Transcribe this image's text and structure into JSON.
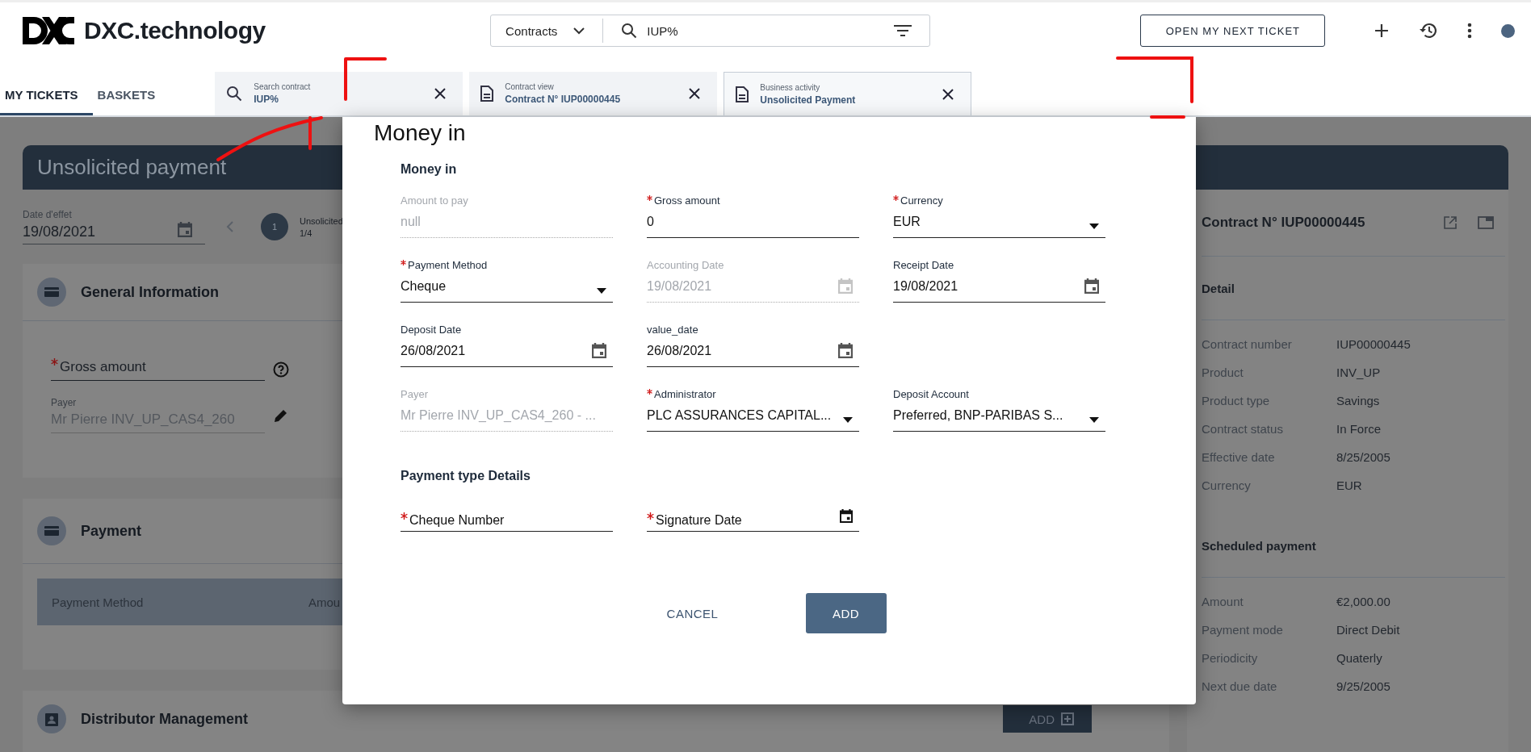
{
  "header": {
    "logo": "DXC.technology",
    "search": {
      "scope": "Contracts",
      "value": "IUP%"
    },
    "next_ticket_button": "OPEN MY NEXT TICKET"
  },
  "nav_tabs": [
    {
      "label": "MY TICKETS",
      "selected": true
    },
    {
      "label": "BASKETS",
      "selected": false
    }
  ],
  "open_tabs": [
    {
      "kind": "search",
      "caption": "Search contract",
      "title": "IUP%",
      "selected": false
    },
    {
      "kind": "document",
      "caption": "Contract view",
      "title": "Contract N° IUP00000445",
      "selected": false
    },
    {
      "kind": "document",
      "caption": "Business activity",
      "title": "Unsolicited Payment",
      "selected": true
    }
  ],
  "page": {
    "title": "Unsolicited payment",
    "effective_date": {
      "label": "Date d'effet",
      "value": "19/08/2021"
    },
    "stepper": {
      "number": "1",
      "label": "Unsolicited",
      "count": "1/4"
    },
    "general_information": {
      "title": "General Information",
      "gross_amount": {
        "label": "Gross amount",
        "required": true
      },
      "payer": {
        "label": "Payer",
        "value": "Mr Pierre INV_UP_CAS4_260"
      }
    },
    "payment": {
      "title": "Payment",
      "columns": [
        "Payment Method",
        "Amou"
      ]
    },
    "distributor": {
      "title": "Distributor Management",
      "add_button": "ADD"
    }
  },
  "contract_panel": {
    "title": "Contract N° IUP00000445",
    "groups": [
      {
        "title": "Detail",
        "rows": [
          {
            "label": "Contract number",
            "value": "IUP00000445"
          },
          {
            "label": "Product",
            "value": "INV_UP"
          },
          {
            "label": "Product type",
            "value": "Savings"
          },
          {
            "label": "Contract status",
            "value": "In Force"
          },
          {
            "label": "Effective date",
            "value": "8/25/2005"
          },
          {
            "label": "Currency",
            "value": "EUR"
          }
        ]
      },
      {
        "title": "Scheduled payment",
        "rows": [
          {
            "label": "Amount",
            "value": "€2,000.00"
          },
          {
            "label": "Payment mode",
            "value": "Direct Debit"
          },
          {
            "label": "Periodicity",
            "value": "Quaterly"
          },
          {
            "label": "Next due date",
            "value": "9/25/2005"
          }
        ]
      }
    ]
  },
  "dialog": {
    "title": "Money in",
    "section": "Money in",
    "rows": [
      [
        {
          "kind": "text",
          "label": "Amount to pay",
          "value": "null",
          "required": false,
          "disabled": true
        },
        {
          "kind": "text",
          "label": "Gross amount",
          "value": "0",
          "required": true,
          "disabled": false
        },
        {
          "kind": "select",
          "label": "Currency",
          "value": "EUR",
          "required": true,
          "disabled": false
        }
      ],
      [
        {
          "kind": "select",
          "label": "Payment Method",
          "value": "Cheque",
          "required": true,
          "disabled": false
        },
        {
          "kind": "date",
          "label": "Accounting Date",
          "value": "19/08/2021",
          "required": false,
          "disabled": true
        },
        {
          "kind": "date",
          "label": "Receipt Date",
          "value": "19/08/2021",
          "required": false,
          "disabled": false
        }
      ],
      [
        {
          "kind": "date",
          "label": "Deposit Date",
          "value": "26/08/2021",
          "required": false,
          "disabled": false
        },
        {
          "kind": "date",
          "label": "value_date",
          "value": "26/08/2021",
          "required": false,
          "disabled": false
        }
      ],
      [
        {
          "kind": "text",
          "label": "Payer",
          "value": "Mr Pierre INV_UP_CAS4_260 - ...",
          "required": false,
          "disabled": true
        },
        {
          "kind": "select",
          "label": "Administrator",
          "value": "PLC ASSURANCES CAPITAL...",
          "required": true,
          "disabled": false
        },
        {
          "kind": "select",
          "label": "Deposit Account",
          "value": "Preferred, BNP-PARIBAS S...",
          "required": false,
          "disabled": false
        }
      ]
    ],
    "details_title": "Payment type Details",
    "detail_fields": [
      {
        "kind": "text",
        "label": "Cheque Number",
        "required": true,
        "disabled": false
      },
      {
        "kind": "date",
        "label": "Signature Date",
        "required": true,
        "disabled": false
      }
    ],
    "buttons": [
      {
        "kind": "text",
        "label": "CANCEL"
      },
      {
        "kind": "primary",
        "label": "ADD"
      }
    ]
  }
}
